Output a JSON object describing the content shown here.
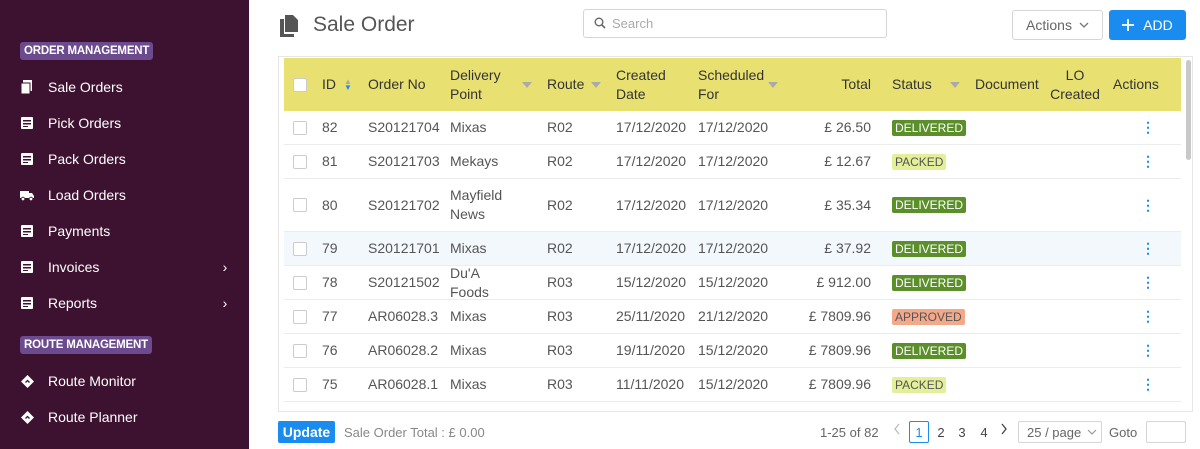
{
  "sidebar": {
    "sections": [
      {
        "title": "ORDER MANAGEMENT"
      },
      {
        "title": "ROUTE MANAGEMENT"
      }
    ],
    "items": [
      {
        "label": "Sale Orders",
        "icon": "documents-icon"
      },
      {
        "label": "Pick Orders",
        "icon": "list-icon"
      },
      {
        "label": "Pack Orders",
        "icon": "list-icon"
      },
      {
        "label": "Load Orders",
        "icon": "truck-icon"
      },
      {
        "label": "Payments",
        "icon": "list-icon"
      },
      {
        "label": "Invoices",
        "icon": "list-icon",
        "chevron": "›"
      },
      {
        "label": "Reports",
        "icon": "list-icon",
        "chevron": "›"
      },
      {
        "label": "Route Monitor",
        "icon": "diamond-icon"
      },
      {
        "label": "Route Planner",
        "icon": "diamond-icon"
      }
    ]
  },
  "header": {
    "title": "Sale Order",
    "search_placeholder": "Search",
    "actions_label": "Actions",
    "add_label": "ADD"
  },
  "table": {
    "columns": {
      "id": "ID",
      "order_no": "Order No",
      "delivery_point": "Delivery Point",
      "route": "Route",
      "created_date": "Created Date",
      "scheduled_for": "Scheduled For",
      "total": "Total",
      "status": "Status",
      "document": "Document",
      "lo_created": "LO Created",
      "actions": "Actions"
    },
    "rows": [
      {
        "id": "82",
        "order_no": "S20121704",
        "delivery_point": "Mixas",
        "route": "R02",
        "created": "17/12/2020",
        "scheduled": "17/12/2020",
        "total": "£ 26.50",
        "status": "DELIVERED"
      },
      {
        "id": "81",
        "order_no": "S20121703",
        "delivery_point": "Mekays",
        "route": "R02",
        "created": "17/12/2020",
        "scheduled": "17/12/2020",
        "total": "£ 12.67",
        "status": "PACKED"
      },
      {
        "id": "80",
        "order_no": "S20121702",
        "delivery_point": "Mayfield News",
        "route": "R02",
        "created": "17/12/2020",
        "scheduled": "17/12/2020",
        "total": "£ 35.34",
        "status": "DELIVERED"
      },
      {
        "id": "79",
        "order_no": "S20121701",
        "delivery_point": "Mixas",
        "route": "R02",
        "created": "17/12/2020",
        "scheduled": "17/12/2020",
        "total": "£ 37.92",
        "status": "DELIVERED"
      },
      {
        "id": "78",
        "order_no": "S20121502",
        "delivery_point": "Du'A Foods",
        "route": "R03",
        "created": "15/12/2020",
        "scheduled": "15/12/2020",
        "total": "£ 912.00",
        "status": "DELIVERED"
      },
      {
        "id": "77",
        "order_no": "AR06028.3",
        "delivery_point": "Mixas",
        "route": "R03",
        "created": "25/11/2020",
        "scheduled": "21/12/2020",
        "total": "£ 7809.96",
        "status": "APPROVED"
      },
      {
        "id": "76",
        "order_no": "AR06028.2",
        "delivery_point": "Mixas",
        "route": "R03",
        "created": "19/11/2020",
        "scheduled": "15/12/2020",
        "total": "£ 7809.96",
        "status": "DELIVERED"
      },
      {
        "id": "75",
        "order_no": "AR06028.1",
        "delivery_point": "Mixas",
        "route": "R03",
        "created": "11/11/2020",
        "scheduled": "15/12/2020",
        "total": "£ 7809.96",
        "status": "PACKED"
      }
    ],
    "row_action_glyph": "⋮"
  },
  "status_colors": {
    "DELIVERED": {
      "bg": "#5a8f2a",
      "fg": "#ffffff"
    },
    "PACKED": {
      "bg": "#e4ef9a",
      "fg": "#555555"
    },
    "APPROVED": {
      "bg": "#f3a889",
      "fg": "#555555"
    }
  },
  "footer": {
    "update_label": "Update",
    "total_text": "Sale Order Total : £ 0.00",
    "range_text": "1-25 of 82",
    "pages": [
      "1",
      "2",
      "3",
      "4"
    ],
    "active_page": "1",
    "page_size": "25 / page",
    "goto_label": "Goto"
  },
  "colors": {
    "sidebar_bg": "#3d1130",
    "section_badge_bg": "#6b4a8d",
    "header_row_bg": "#e8e172",
    "accent": "#1a8cf0"
  }
}
